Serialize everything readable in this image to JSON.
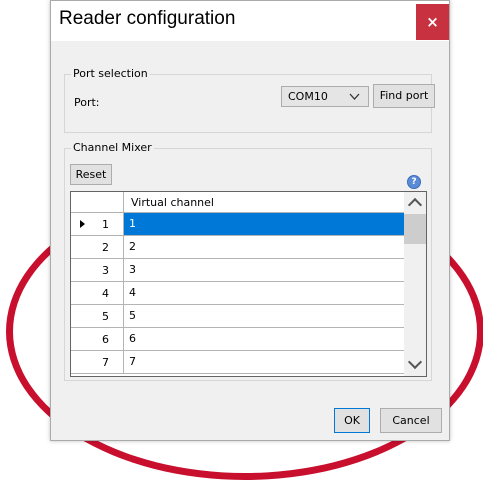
{
  "dialog": {
    "title": "Reader configuration",
    "close_glyph": "×"
  },
  "port_selection": {
    "legend": "Port selection",
    "port_label": "Port:",
    "port_value": "COM10",
    "dropdown_icon": "chevron-down-icon",
    "find_port_label": "Find port"
  },
  "channel_mixer": {
    "legend": "Channel Mixer",
    "reset_label": "Reset",
    "help_icon": "help-icon",
    "help_glyph": "?",
    "column_header": "Virtual channel",
    "rows": [
      {
        "num": "1",
        "value": "1",
        "selected": true
      },
      {
        "num": "2",
        "value": "2",
        "selected": false
      },
      {
        "num": "3",
        "value": "3",
        "selected": false
      },
      {
        "num": "4",
        "value": "4",
        "selected": false
      },
      {
        "num": "5",
        "value": "5",
        "selected": false
      },
      {
        "num": "6",
        "value": "6",
        "selected": false
      },
      {
        "num": "7",
        "value": "7",
        "selected": false
      }
    ]
  },
  "buttons": {
    "ok_label": "OK",
    "cancel_label": "Cancel"
  },
  "colors": {
    "annotation_ring": "#c8102e",
    "close_button": "#c8313f",
    "selection": "#0078d7"
  }
}
